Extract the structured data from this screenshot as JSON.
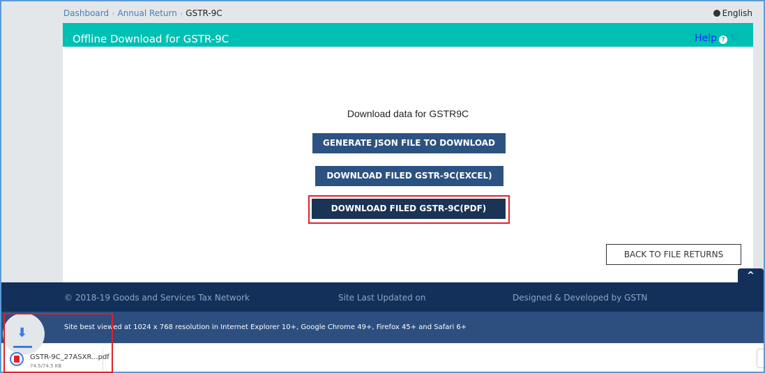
{
  "breadcrumb": {
    "items": [
      "Dashboard",
      "Annual Return"
    ],
    "current": "GSTR-9C"
  },
  "language": "English",
  "card": {
    "title": "Offline Download for GSTR-9C",
    "help_label": "Help",
    "help_icon": "?",
    "refresh_icon": "↻"
  },
  "download": {
    "title": "Download data for GSTR9C",
    "generate_json_label": "GENERATE JSON FILE TO DOWNLOAD",
    "download_excel_label": "DOWNLOAD FILED GSTR-9C(EXCEL)",
    "download_pdf_label": "DOWNLOAD FILED GSTR-9C(PDF)",
    "back_label": "BACK TO FILE RETURNS"
  },
  "scroll_top_icon": "^",
  "footer": {
    "copyright": "© 2018-19 Goods and Services Tax Network",
    "last_updated": "Site Last Updated on",
    "developed_by": "Designed & Developed by GSTN",
    "best_viewed": "Site best viewed at 1024 x 768 resolution in Internet Explorer 10+, Google Chrome 49+, Firefox 45+ and Safari 6+"
  },
  "download_bar": {
    "arrow_icon": "🡇",
    "file_name": "GSTR-9C_27ASXR...pdf",
    "file_size": "74.5/74.5 KB",
    "progress": 1.0
  },
  "colors": {
    "header_teal": "#00bfb3",
    "button_blue": "#2c5282",
    "button_dark": "#1b3354",
    "footer_dark": "#13305a",
    "footer_mid": "#2c4f80",
    "highlight_red": "#e0202a"
  }
}
